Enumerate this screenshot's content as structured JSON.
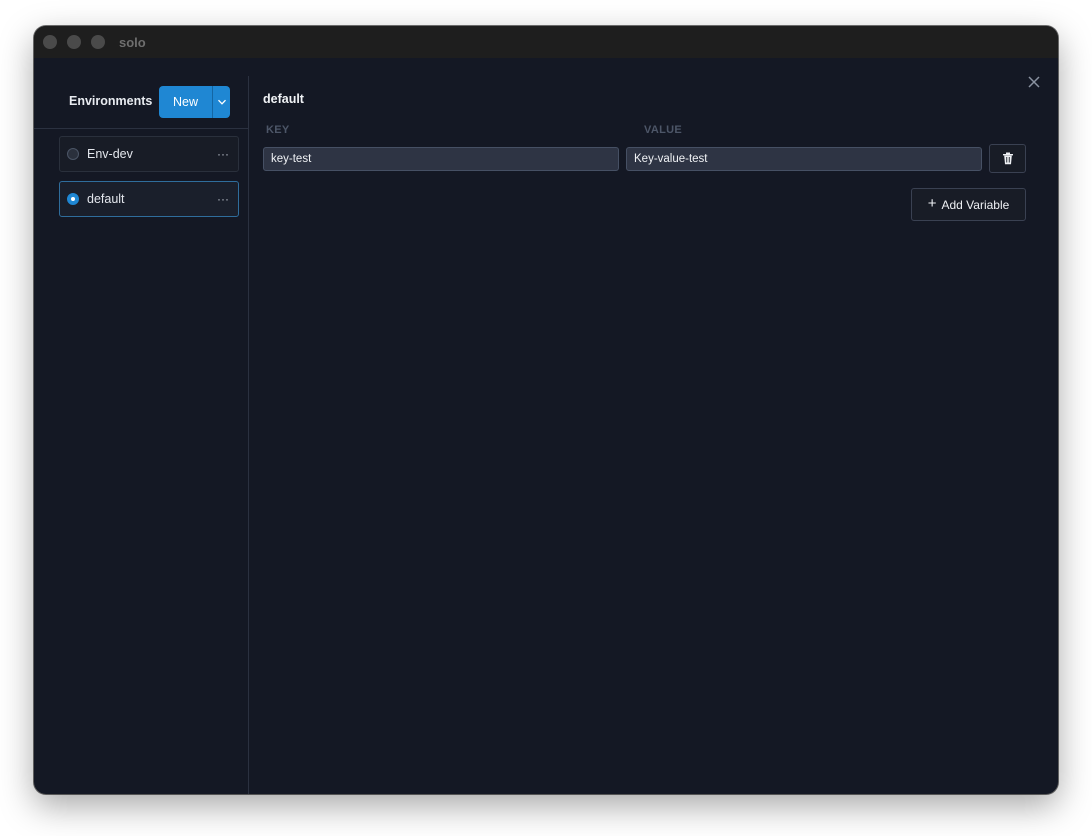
{
  "window": {
    "title": "solo"
  },
  "sidebar": {
    "title": "Environments",
    "new_button": {
      "label": "New"
    },
    "environments": [
      {
        "name": "Env-dev",
        "selected": false,
        "menu": "···"
      },
      {
        "name": "default",
        "selected": true,
        "menu": "···"
      }
    ]
  },
  "main": {
    "environment_name": "default",
    "columns": {
      "key": "KEY",
      "value": "VALUE"
    },
    "variables": [
      {
        "key": "key-test",
        "value": "Key-value-test"
      }
    ],
    "add_variable_label": "Add Variable",
    "add_variable_icon": "plus-icon"
  },
  "colors": {
    "accent": "#1f87d3",
    "background": "#141824",
    "titlebar": "#1e1e1e"
  }
}
